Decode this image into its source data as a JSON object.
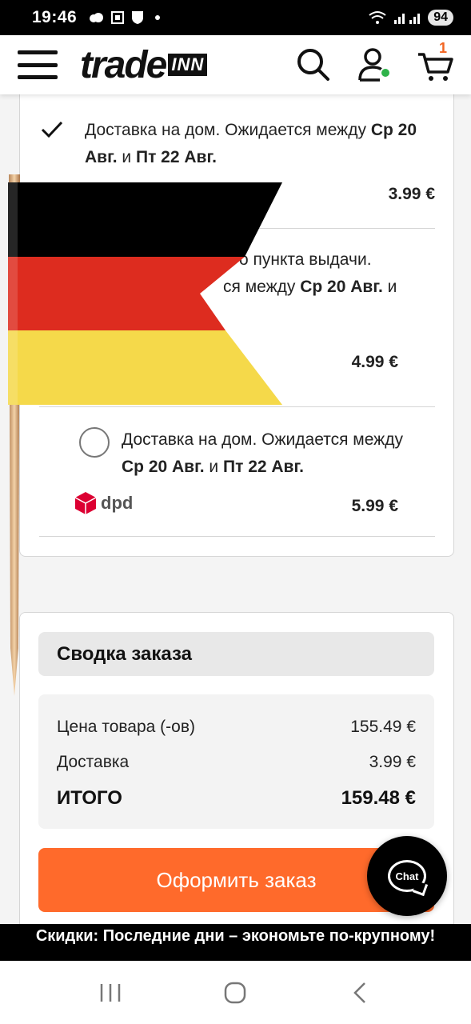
{
  "status_bar": {
    "time": "19:46",
    "battery": "94"
  },
  "header": {
    "logo_main": "trade",
    "logo_sub": "INN",
    "cart_count": "1"
  },
  "shipping_options": [
    {
      "text_prefix": "Доставка на дом. Ожидается между ",
      "date_from": "Ср 20 Авг.",
      "connector": " и ",
      "date_to": "Пт 22 Авг.",
      "price": "3.99 €",
      "selected": true
    },
    {
      "text_line1": "о пункта выдачи.",
      "text_line2_prefix": "ся между ",
      "date_from": "Ср 20 Авг.",
      "connector": " и",
      "price": "4.99 €",
      "selected": false
    },
    {
      "text_prefix": "Доставка на дом. Ожидается между ",
      "date_from": "Ср 20 Авг.",
      "connector": " и ",
      "date_to": "Пт 22 Авг.",
      "price": "5.99 €",
      "carrier": "dpd",
      "selected": false
    }
  ],
  "summary": {
    "title": "Сводка заказа",
    "item_price_label": "Цена товара (-ов)",
    "item_price_value": "155.49 €",
    "shipping_label": "Доставка",
    "shipping_value": "3.99 €",
    "total_label": "ИТОГО",
    "total_value": "159.48 €",
    "checkout_label": "Оформить заказ"
  },
  "chat": {
    "label": "Chat"
  },
  "promo": {
    "text": "Скидки: Последние дни – экономьте по-крупному!"
  },
  "colors": {
    "accent": "#ff6a2b",
    "cart_badge": "#f26522",
    "online": "#2fb34a",
    "flag_black": "#000000",
    "flag_red": "#dd2c1f",
    "flag_gold": "#f5d94a"
  }
}
